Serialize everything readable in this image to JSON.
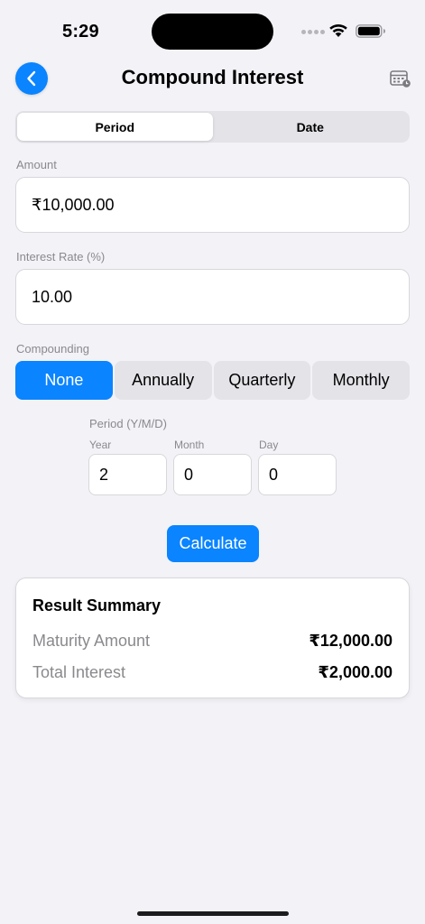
{
  "status_bar": {
    "time": "5:29"
  },
  "header": {
    "title": "Compound Interest"
  },
  "tabs": [
    {
      "label": "Period",
      "active": true
    },
    {
      "label": "Date",
      "active": false
    }
  ],
  "amount": {
    "label": "Amount",
    "value": "₹10,000.00"
  },
  "interest_rate": {
    "label": "Interest Rate (%)",
    "value": "10.00"
  },
  "compounding": {
    "label": "Compounding",
    "options": [
      {
        "label": "None",
        "active": true
      },
      {
        "label": "Annually",
        "active": false
      },
      {
        "label": "Quarterly",
        "active": false
      },
      {
        "label": "Monthly",
        "active": false
      }
    ]
  },
  "period": {
    "label": "Period (Y/M/D)",
    "year": {
      "label": "Year",
      "value": "2"
    },
    "month": {
      "label": "Month",
      "value": "0"
    },
    "day": {
      "label": "Day",
      "value": "0"
    }
  },
  "calculate_label": "Calculate",
  "result": {
    "title": "Result Summary",
    "maturity_label": "Maturity Amount",
    "maturity_value": "₹12,000.00",
    "interest_label": "Total Interest",
    "interest_value": "₹2,000.00"
  },
  "colors": {
    "accent": "#0a84ff",
    "background": "#f2f2f7"
  }
}
